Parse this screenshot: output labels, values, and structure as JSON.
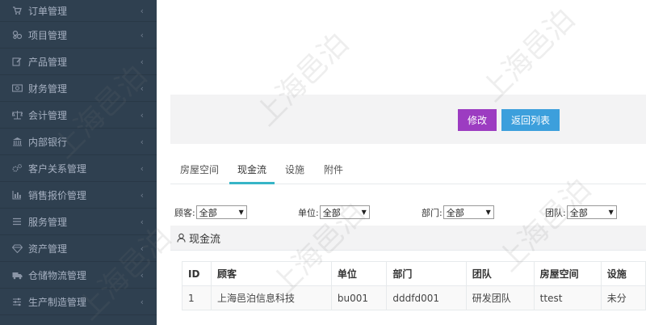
{
  "sidebar": {
    "items": [
      {
        "label": "订单管理",
        "icon": "cart-icon"
      },
      {
        "label": "项目管理",
        "icon": "project-icon"
      },
      {
        "label": "产品管理",
        "icon": "edit-icon"
      },
      {
        "label": "财务管理",
        "icon": "money-icon"
      },
      {
        "label": "会计管理",
        "icon": "balance-icon"
      },
      {
        "label": "内部银行",
        "icon": "bank-icon"
      },
      {
        "label": "客户关系管理",
        "icon": "gears-icon"
      },
      {
        "label": "销售报价管理",
        "icon": "bar-chart-icon"
      },
      {
        "label": "服务管理",
        "icon": "list-icon"
      },
      {
        "label": "资产管理",
        "icon": "diamond-icon"
      },
      {
        "label": "仓储物流管理",
        "icon": "truck-icon"
      },
      {
        "label": "生产制造管理",
        "icon": "sliders-icon"
      }
    ],
    "chevron": "‹"
  },
  "toolbar": {
    "edit_label": "修改",
    "back_label": "返回列表"
  },
  "tabs": [
    {
      "label": "房屋空间",
      "active": false
    },
    {
      "label": "现金流",
      "active": true
    },
    {
      "label": "设施",
      "active": false
    },
    {
      "label": "附件",
      "active": false
    }
  ],
  "filters": [
    {
      "label": "顾客:",
      "value": "全部"
    },
    {
      "label": "单位:",
      "value": "全部"
    },
    {
      "label": "部门:",
      "value": "全部"
    },
    {
      "label": "团队:",
      "value": "全部"
    }
  ],
  "panel": {
    "title": "现金流"
  },
  "table": {
    "headers": [
      "ID",
      "顾客",
      "单位",
      "部门",
      "团队",
      "房屋空间",
      "设施"
    ],
    "rows": [
      [
        "1",
        "上海邑泊信息科技",
        "bu001",
        "dddfd001",
        "研发团队",
        "ttest",
        "未分"
      ]
    ]
  },
  "watermark": "上海邑泊"
}
